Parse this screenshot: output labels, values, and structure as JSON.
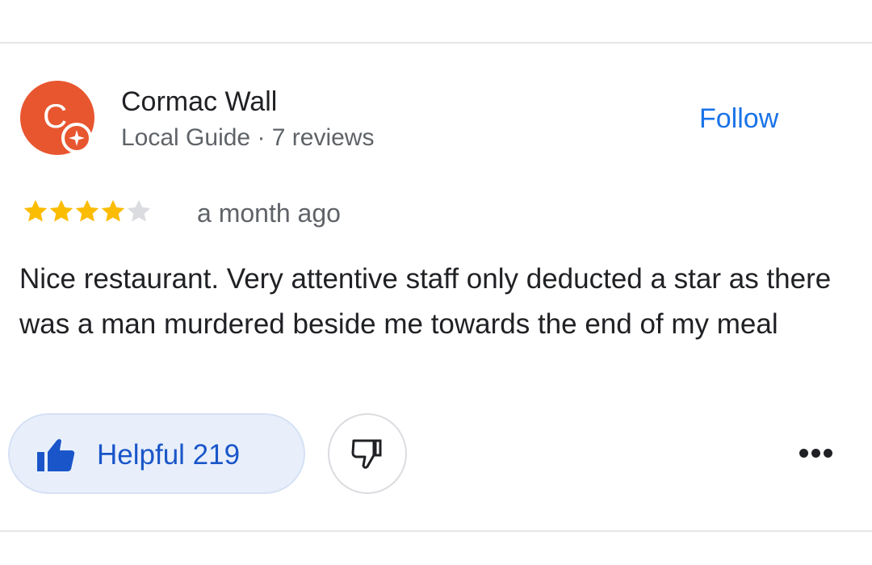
{
  "review": {
    "author": {
      "initial": "C",
      "name": "Cormac Wall",
      "meta": "Local Guide · 7 reviews",
      "avatar_color": "#e8562f",
      "badge_icon": "local-guide-star-icon"
    },
    "follow_label": "Follow",
    "rating": {
      "value": 4,
      "max": 5
    },
    "time_ago": "a month ago",
    "text": "Nice restaurant. Very attentive staff only deducted a star as there was a man murdered beside me towards the end of my meal",
    "helpful": {
      "label": "Helpful 219",
      "icon": "thumbs-up-icon"
    },
    "dislike_icon": "thumbs-down-icon",
    "more_icon": "more-options-icon"
  },
  "colors": {
    "accent": "#1a73e8",
    "helpful_text": "#1a56c9",
    "helpful_bg": "#e8effb",
    "star_filled": "#fbbc04",
    "star_empty": "#dadce0",
    "secondary_text": "#5f6368"
  }
}
